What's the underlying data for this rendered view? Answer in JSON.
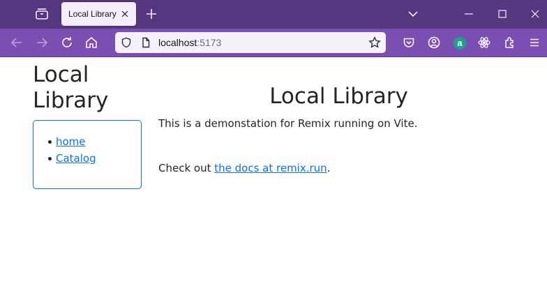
{
  "browser": {
    "tab": {
      "title": "Local Library"
    },
    "url": {
      "host": "localhost",
      "port": ":5173"
    }
  },
  "page": {
    "sidebar": {
      "title": "Local Library",
      "links": [
        {
          "label": "home"
        },
        {
          "label": "Catalog"
        }
      ]
    },
    "main": {
      "heading": "Local Library",
      "intro": "This is a demonstation for Remix running on Vite.",
      "docs_prefix": "Check out ",
      "docs_link": "the docs at remix.run",
      "docs_suffix": "."
    }
  },
  "extensions": {
    "badge_letter": "a"
  },
  "colors": {
    "tabstrip": "#55377f",
    "navbar": "#7b4fb1",
    "link": "#0d6efd",
    "nav_border": "#0d6efd"
  },
  "icons": [
    "tab-list-icon",
    "close-tab-icon",
    "new-tab-icon",
    "list-all-tabs-icon",
    "minimize-icon",
    "maximize-icon",
    "close-window-icon",
    "back-icon",
    "forward-icon",
    "reload-icon",
    "home-icon",
    "shield-icon",
    "page-icon",
    "bookmark-star-icon",
    "pocket-icon",
    "account-icon",
    "extension-a-icon",
    "react-devtools-icon",
    "extensions-icon",
    "menu-icon"
  ]
}
